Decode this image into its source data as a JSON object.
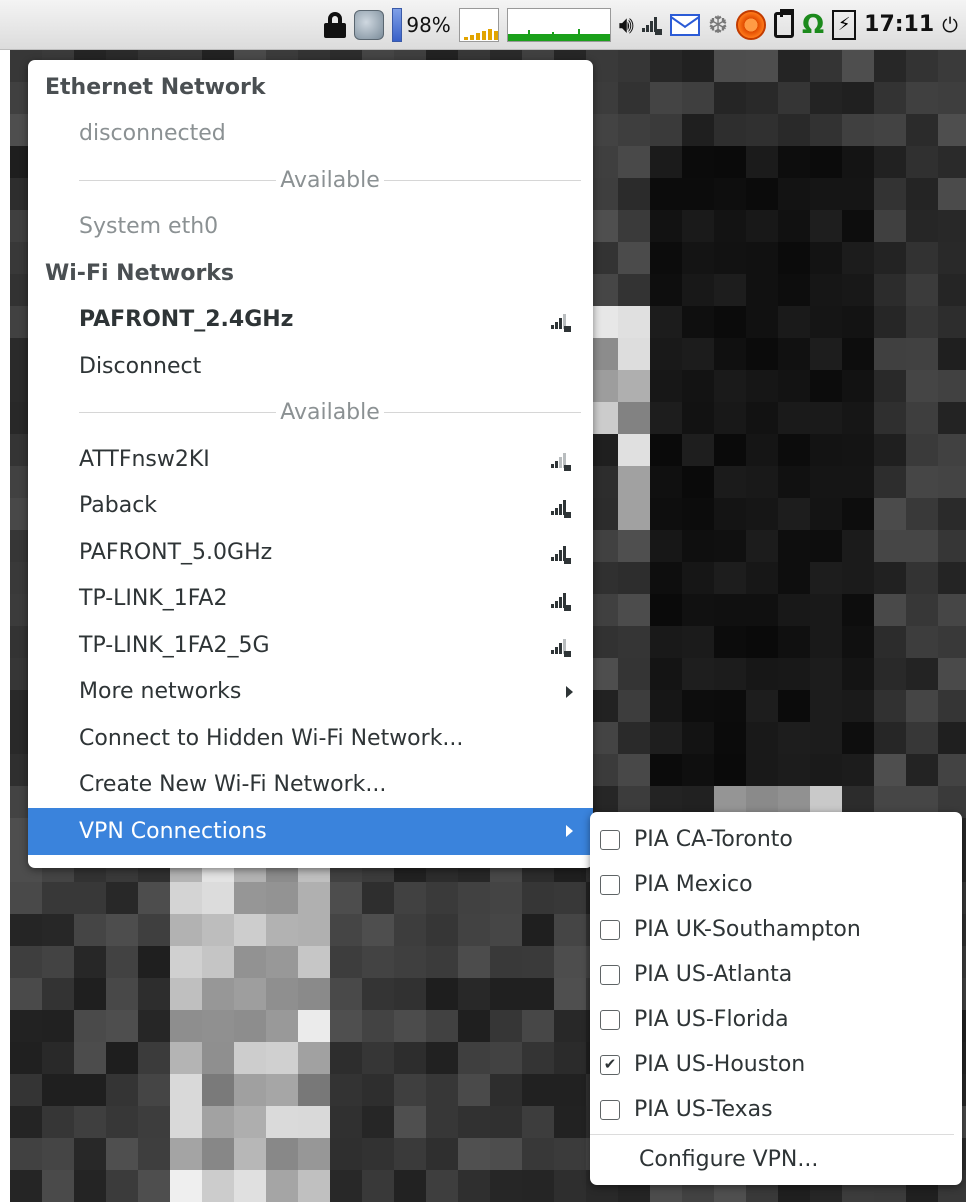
{
  "panel": {
    "battery_percent": "98%",
    "clock": "17:11",
    "cpu_graph": [
      3,
      5,
      7,
      9,
      11,
      9
    ],
    "icons": [
      "lock-icon",
      "app-icon",
      "battery-bar",
      "cpu-graph",
      "network-graph",
      "volume-icon",
      "signal-icon",
      "mail-icon",
      "snowflake-icon",
      "alert-icon",
      "clipboard-icon",
      "omega-icon",
      "power-bolt-icon",
      "power-button-icon"
    ]
  },
  "menu": {
    "ethernet_header": "Ethernet Network",
    "ethernet_status": "disconnected",
    "available_label_1": "Available",
    "system_eth0": "System eth0",
    "wifi_header": "Wi-Fi Networks",
    "connected_network": "PAFRONT_2.4GHz",
    "disconnect": "Disconnect",
    "available_label_2": "Available",
    "networks": [
      {
        "name": "ATTFnsw2KI",
        "strength": 2
      },
      {
        "name": "Paback",
        "strength": 4
      },
      {
        "name": "PAFRONT_5.0GHz",
        "strength": 4
      },
      {
        "name": "TP-LINK_1FA2",
        "strength": 4
      },
      {
        "name": "TP-LINK_1FA2_5G",
        "strength": 3
      }
    ],
    "connected_strength": 3,
    "more_networks": "More networks",
    "connect_hidden": "Connect to Hidden Wi-Fi Network...",
    "create_new": "Create New Wi-Fi Network...",
    "vpn_connections": "VPN Connections"
  },
  "vpn": {
    "items": [
      {
        "label": "PIA CA-Toronto",
        "checked": false
      },
      {
        "label": "PIA Mexico",
        "checked": false
      },
      {
        "label": "PIA UK-Southampton",
        "checked": false
      },
      {
        "label": "PIA US-Atlanta",
        "checked": false
      },
      {
        "label": "PIA US-Florida",
        "checked": false
      },
      {
        "label": "PIA US-Houston",
        "checked": true
      },
      {
        "label": "PIA US-Texas",
        "checked": false
      }
    ],
    "configure": "Configure VPN..."
  },
  "colors": {
    "highlight": "#3a83dc",
    "panel_bg": "#e4e4e4",
    "net_graph": "#1aa01a",
    "cpu_graph": "#e2a400"
  }
}
